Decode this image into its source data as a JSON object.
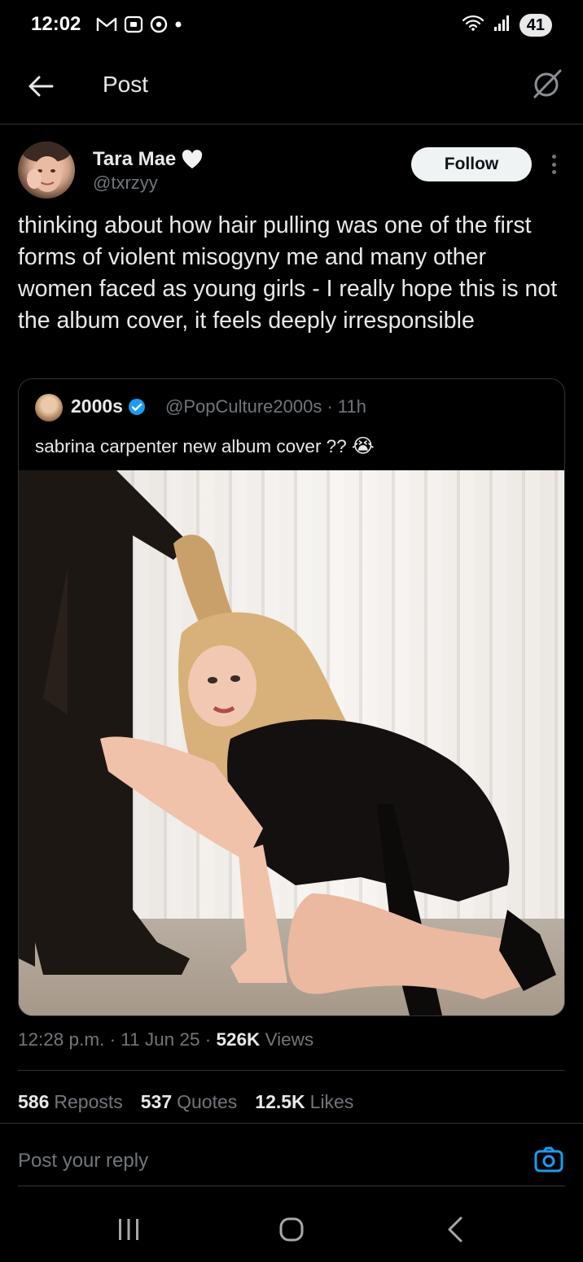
{
  "status_bar": {
    "time": "12:02",
    "left_icons": [
      "gmail-icon",
      "screenshot-icon",
      "chrome-icon",
      "dot-icon"
    ],
    "battery": "41"
  },
  "header": {
    "title": "Post"
  },
  "post": {
    "author_name": "Tara Mae",
    "author_handle": "@txrzyy",
    "follow_label": "Follow",
    "text": "thinking about how hair pulling was one of the first forms of violent misogyny me and many other women faced as young girls - I really hope this is not the album cover, it feels deeply irresponsible",
    "quote": {
      "name": "2000s",
      "handle_time": "@PopCulture2000s · 11h",
      "text": "sabrina carpenter new album cover ??",
      "emoji": "😭"
    },
    "meta": {
      "time_date": "12:28 p.m. · 11 Jun 25 · ",
      "views_count": "526K",
      "views_label": " Views"
    },
    "stats": [
      {
        "count": "586",
        "label": "Reposts"
      },
      {
        "count": "537",
        "label": "Quotes"
      },
      {
        "count": "12.5K",
        "label": "Likes"
      }
    ]
  },
  "reply": {
    "placeholder": "Post your reply"
  },
  "colors": {
    "background": "#000000",
    "text": "#e7e9ea",
    "secondary_text": "#71767b",
    "divider": "#2f3336",
    "verified_blue": "#1d9bf0"
  }
}
